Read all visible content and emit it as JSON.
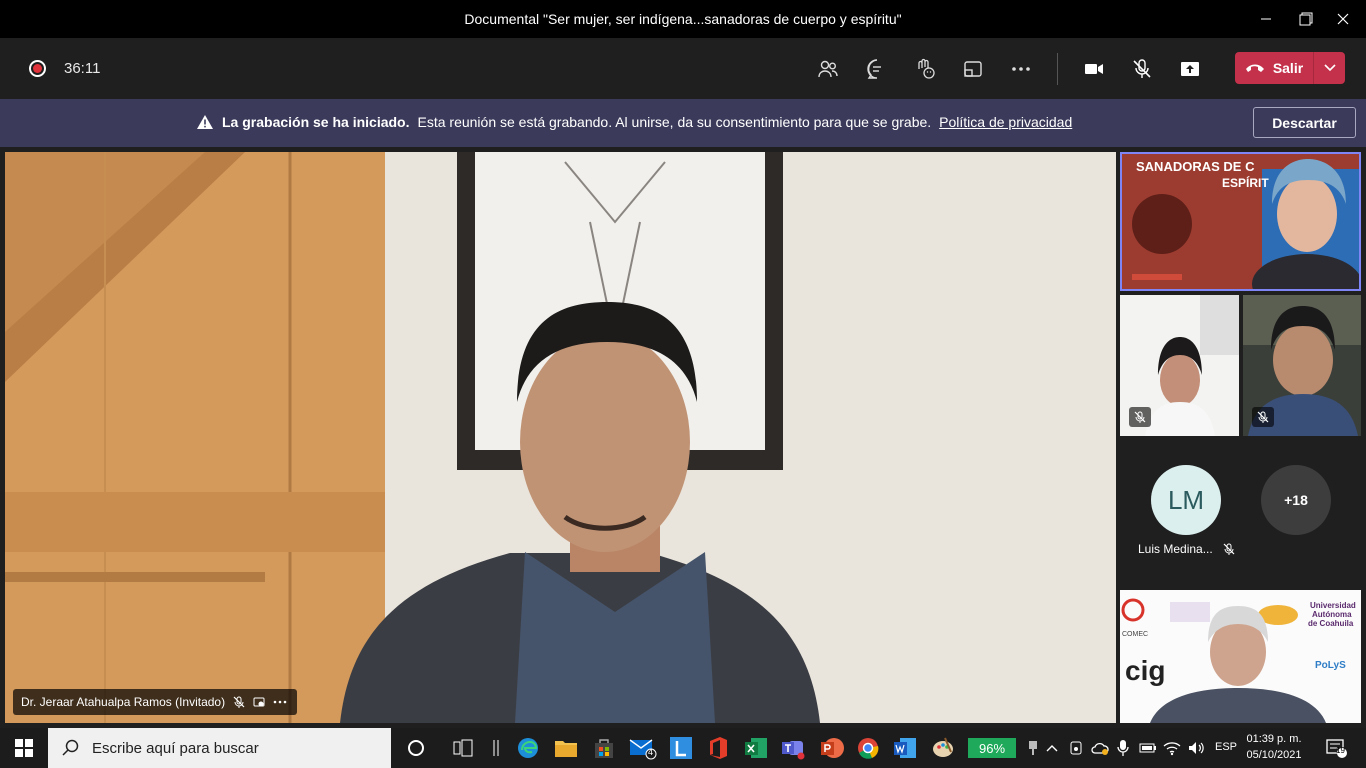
{
  "window": {
    "title": "Documental \"Ser mujer, ser indígena...sanadoras de cuerpo y espíritu\""
  },
  "toolbar": {
    "timer": "36:11",
    "leave_label": "Salir"
  },
  "banner": {
    "bold": "La grabación se ha iniciado.",
    "text": "Esta reunión se está grabando. Al unirse, da su consentimiento para que se grabe.",
    "link": "Política de privacidad",
    "dismiss": "Descartar"
  },
  "main_video": {
    "name": "Dr. Jeraar Atahualpa Ramos (Invitado)"
  },
  "tiles": {
    "slide_title_1": "SANADORAS DE C",
    "slide_title_2": "ESPÍRIT",
    "lm_initials": "LM",
    "lm_name": "Luis Medina...",
    "more_count": "+18",
    "logo_comec": "COMEC",
    "logo_cig": "cig",
    "logo_uac_1": "Universidad",
    "logo_uac_2": "Autónoma",
    "logo_uac_3": "de Coahuila",
    "logo_polys": "PoLyS"
  },
  "taskbar": {
    "search_placeholder": "Escribe aquí para buscar",
    "mail_badge": "4",
    "battery": "96%",
    "lang": "ESP",
    "time": "01:39 p. m.",
    "date": "05/10/2021",
    "notifications": "19"
  },
  "colors": {
    "accent": "#7f85f5",
    "leave": "#c4314b",
    "banner": "#3b3a5b",
    "battery": "#1fa95a"
  }
}
